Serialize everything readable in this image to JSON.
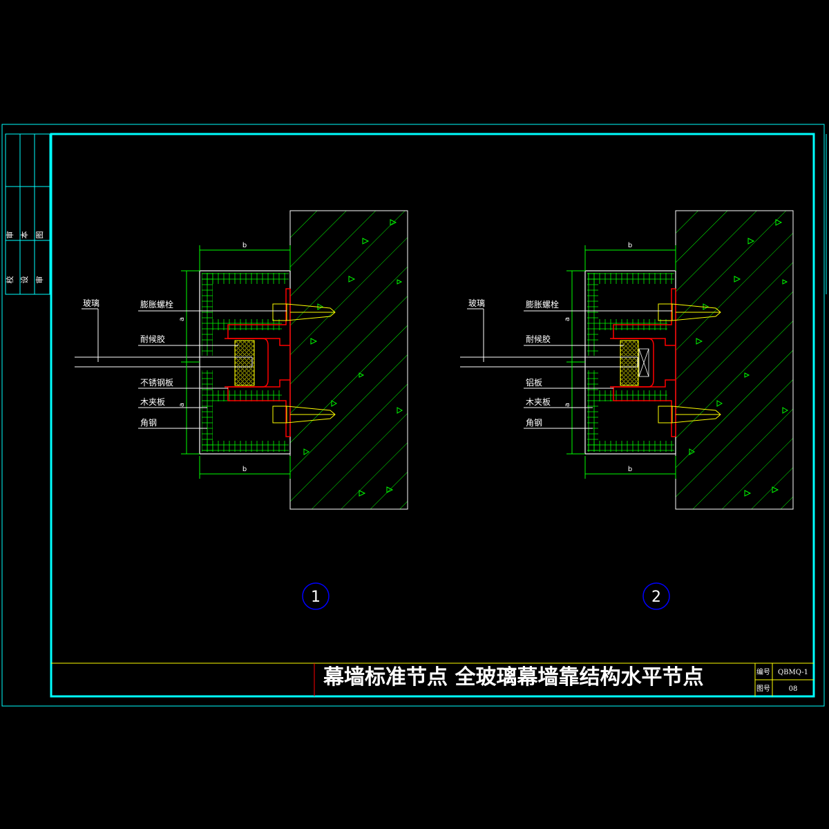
{
  "colors": {
    "background": "#000000",
    "frame_cyan": "#00ffff",
    "hatch_green": "#00ff00",
    "section_red": "#ff0000",
    "title_yellow": "#ffff00",
    "circle_blue": "#0000ff",
    "text": "#ffffff"
  },
  "sidebar": {
    "columns": [
      {
        "top": "图",
        "bottom": "审"
      },
      {
        "top": "本",
        "bottom": "设"
      },
      {
        "top": "审",
        "bottom": "校"
      }
    ]
  },
  "details": [
    {
      "number": "1",
      "labels": {
        "glass": "玻璃",
        "bolt": "膨胀螺栓",
        "sealant": "耐候胶",
        "plate": "不锈钢板",
        "board": "木夹板",
        "angle": "角钢"
      },
      "dims": {
        "top": "b",
        "bottom": "b",
        "upper": "a",
        "lower": "a"
      }
    },
    {
      "number": "2",
      "labels": {
        "glass": "玻璃",
        "bolt": "膨胀螺栓",
        "sealant": "耐候胶",
        "plate": "铝板",
        "board": "木夹板",
        "angle": "角钢"
      },
      "dims": {
        "top": "b",
        "bottom": "b",
        "upper": "a",
        "lower": "a"
      }
    }
  ],
  "title_block": {
    "title": "幕墙标准节点 全玻璃幕墙靠结构水平节点",
    "code_label": "编号",
    "code_value": "QBMQ-1",
    "sheet_label": "图号",
    "sheet_value": "08"
  }
}
